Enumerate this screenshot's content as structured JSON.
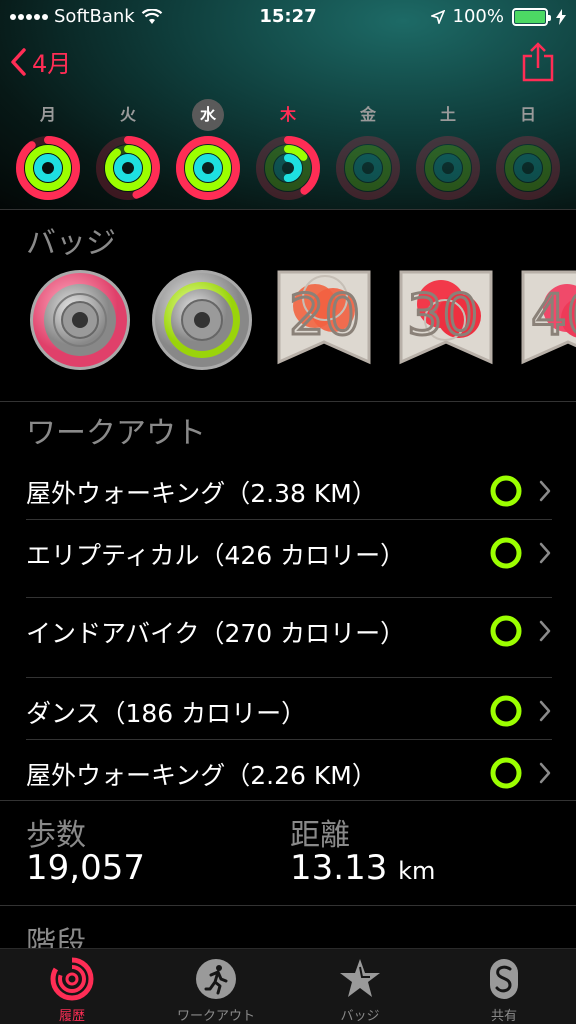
{
  "status_bar": {
    "carrier": "SoftBank",
    "time": "15:27",
    "battery": "100%"
  },
  "nav": {
    "back_label": "4月"
  },
  "week": [
    {
      "label": "月",
      "move": 0.9,
      "exercise": 1.0,
      "stand": 1.0,
      "state": "normal"
    },
    {
      "label": "火",
      "move": 0.45,
      "exercise": 0.9,
      "stand": 1.0,
      "state": "normal"
    },
    {
      "label": "水",
      "move": 1.0,
      "exercise": 1.0,
      "stand": 1.0,
      "state": "selected"
    },
    {
      "label": "木",
      "move": 0.4,
      "exercise": 0.15,
      "stand": 0.5,
      "state": "today"
    },
    {
      "label": "金",
      "move": 0,
      "exercise": 0,
      "stand": 0,
      "state": "normal"
    },
    {
      "label": "土",
      "move": 0,
      "exercise": 0,
      "stand": 0,
      "state": "normal"
    },
    {
      "label": "日",
      "move": 0,
      "exercise": 0,
      "stand": 0,
      "state": "normal"
    }
  ],
  "badges_section": {
    "title": "バッジ"
  },
  "workouts_section": {
    "title": "ワークアウト",
    "items": [
      {
        "label": "屋外ウォーキング（2.38 KM）"
      },
      {
        "label": "エリプティカル（426 カロリー）"
      },
      {
        "label": "インドアバイク（270 カロリー）"
      },
      {
        "label": "ダンス（186 カロリー）"
      },
      {
        "label": "屋外ウォーキング（2.26 KM）"
      }
    ]
  },
  "stats": {
    "steps_label": "歩数",
    "steps_value": "19,057",
    "distance_label": "距離",
    "distance_value": "13.13",
    "distance_unit": "km",
    "stairs_label": "階段"
  },
  "tabbar": {
    "tabs": [
      {
        "label": "履歴",
        "icon": "activity-rings-icon",
        "active": true
      },
      {
        "label": "ワークアウト",
        "icon": "running-figure-icon",
        "active": false
      },
      {
        "label": "バッジ",
        "icon": "star-badge-icon",
        "active": false
      },
      {
        "label": "共有",
        "icon": "sharing-s-icon",
        "active": false
      }
    ]
  },
  "colors": {
    "move": "#ff2d55",
    "exercise": "#9cff00",
    "stand": "#1ee0e0",
    "accent": "#ff2d55"
  }
}
